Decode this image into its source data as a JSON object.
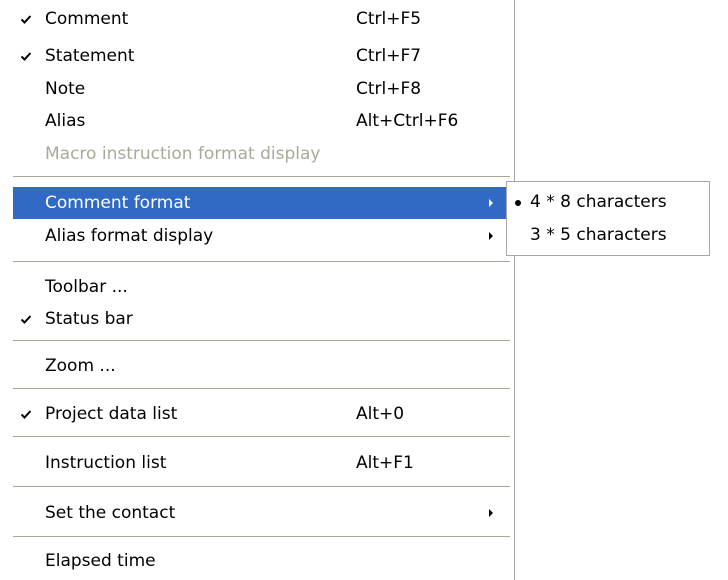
{
  "menu": {
    "comment": {
      "label": "Comment",
      "shortcut": "Ctrl+F5",
      "checked": true
    },
    "statement": {
      "label": "Statement",
      "shortcut": "Ctrl+F7",
      "checked": true
    },
    "note": {
      "label": "Note",
      "shortcut": "Ctrl+F8"
    },
    "alias": {
      "label": "Alias",
      "shortcut": "Alt+Ctrl+F6"
    },
    "macro": {
      "label": "Macro instruction format display",
      "disabled": true
    },
    "comment_format": {
      "label": "Comment format",
      "highlighted": true,
      "has_submenu": true
    },
    "alias_format": {
      "label": "Alias format display",
      "has_submenu": true
    },
    "toolbar": {
      "label": "Toolbar ..."
    },
    "status_bar": {
      "label": "Status bar",
      "checked": true
    },
    "zoom": {
      "label": "Zoom ..."
    },
    "project_data_list": {
      "label": "Project data list",
      "shortcut": "Alt+0",
      "checked": true
    },
    "instruction_list": {
      "label": "Instruction list",
      "shortcut": "Alt+F1"
    },
    "set_contact": {
      "label": "Set the contact",
      "has_submenu": true
    },
    "elapsed_time": {
      "label": "Elapsed time"
    }
  },
  "submenu": {
    "opt1": {
      "label": "4 * 8 characters",
      "selected": true
    },
    "opt2": {
      "label": "3 * 5 characters"
    }
  },
  "colors": {
    "highlight": "#316ac5",
    "disabled_text": "#aca899",
    "separator": "#aca899",
    "border": "#a7a6aa"
  },
  "icons": {
    "check": "check-icon",
    "submenu_arrow": "submenu-arrow-icon",
    "radio_bullet": "radio-bullet-icon"
  }
}
